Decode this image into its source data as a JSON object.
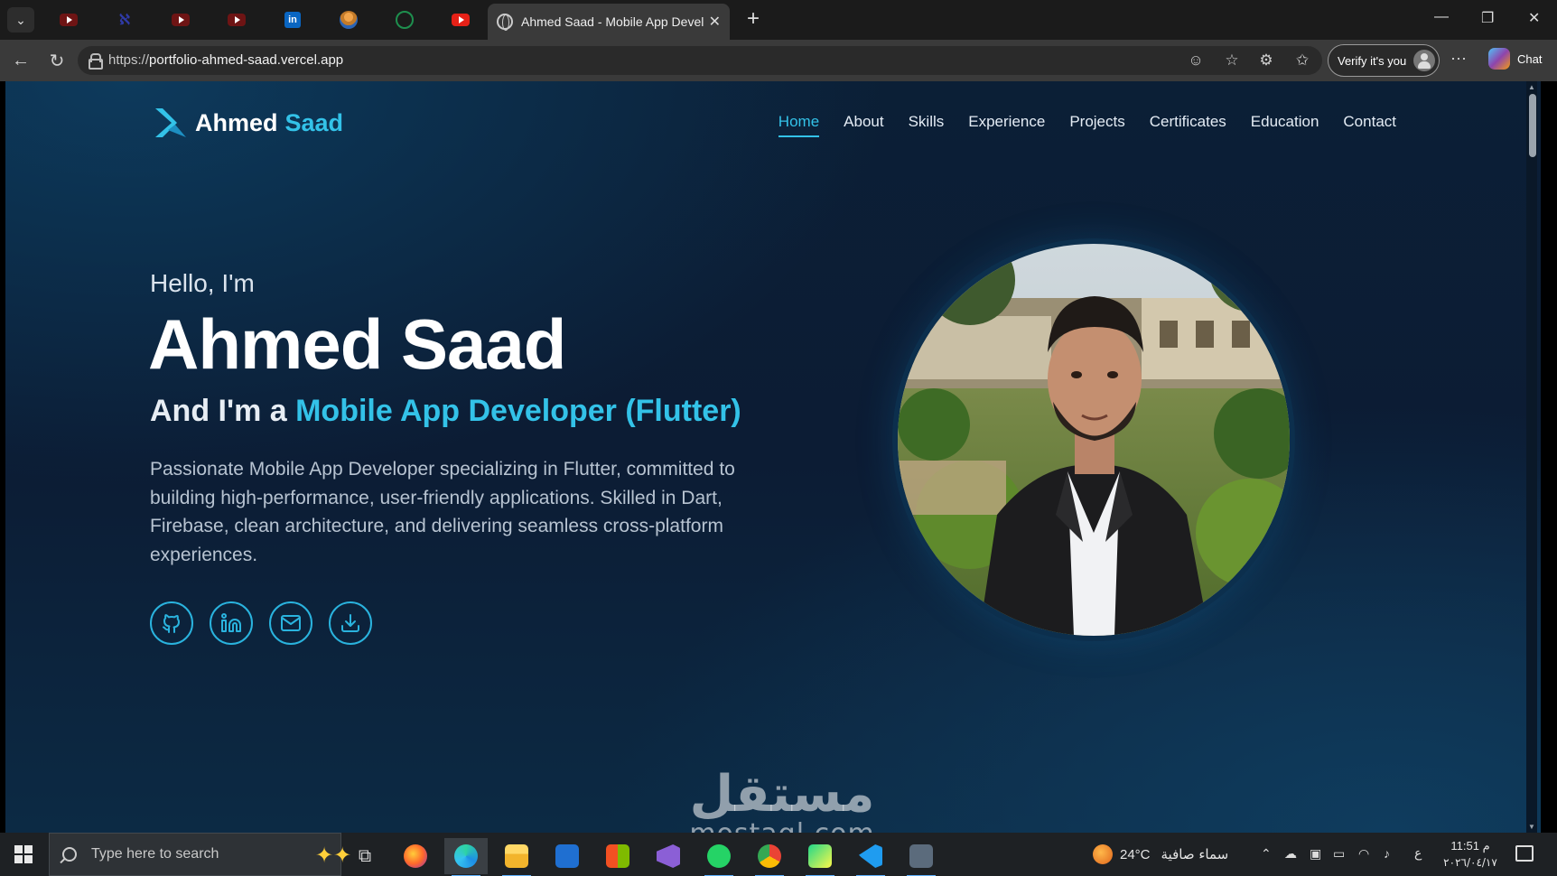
{
  "browser": {
    "active_tab_title": "Ahmed Saad - Mobile App Develo",
    "url_prefix": "https://",
    "url_host": "portfolio-ahmed-saad.vercel.app",
    "verify_label": "Verify it's you",
    "chat_label": "Chat",
    "pinned_tabs": [
      "youtube",
      "nvidia",
      "youtube",
      "youtube",
      "linkedin",
      "profile",
      "whatsapp",
      "youtube"
    ],
    "linkedin_glyph": "in",
    "nvidia_glyph": "ℵ"
  },
  "site": {
    "brand_first": "Ahmed",
    "brand_last": "Saad",
    "nav": [
      "Home",
      "About",
      "Skills",
      "Experience",
      "Projects",
      "Certificates",
      "Education",
      "Contact"
    ],
    "active_nav": "Home"
  },
  "hero": {
    "greeting": "Hello, I'm",
    "name": "Ahmed Saad",
    "role_prefix": "And I'm a",
    "role": "Mobile App Developer (Flutter)",
    "bio": "Passionate Mobile App Developer specializing in Flutter, committed to building high-performance, user-friendly applications. Skilled in Dart, Firebase, clean architecture, and delivering seamless cross-platform experiences.",
    "socials": [
      "github-icon",
      "linkedin-icon",
      "mail-icon",
      "download-icon"
    ]
  },
  "watermark": {
    "arabic": "مستقل",
    "latin": "mostaql.com"
  },
  "taskbar": {
    "search_placeholder": "Type here to search",
    "temperature": "24°C",
    "weather_text": "سماء صافية",
    "lang": "ع",
    "time": "11:51 م",
    "date": "٢٠٢٦/٠٤/١٧"
  },
  "colors": {
    "accent": "#33c2e8",
    "page_bg": "#0c1c34",
    "browser_chrome": "#3a3a3a"
  }
}
